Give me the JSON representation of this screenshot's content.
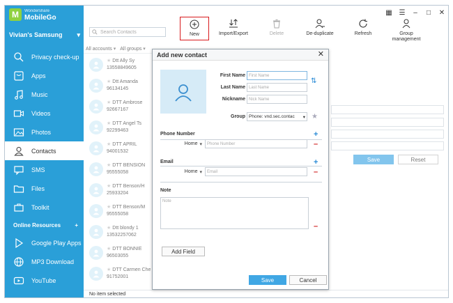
{
  "app": {
    "brand": "Wondershare",
    "product": "MobileGo",
    "device": "Vivian's Samsung"
  },
  "nav": {
    "items": [
      {
        "label": "Privacy check-up",
        "icon": "search-icon"
      },
      {
        "label": "Apps",
        "icon": "apps-icon"
      },
      {
        "label": "Music",
        "icon": "music-icon"
      },
      {
        "label": "Videos",
        "icon": "video-icon"
      },
      {
        "label": "Photos",
        "icon": "photo-icon"
      },
      {
        "label": "Contacts",
        "icon": "contacts-icon",
        "active": true
      },
      {
        "label": "SMS",
        "icon": "sms-icon"
      },
      {
        "label": "Files",
        "icon": "folder-icon"
      },
      {
        "label": "Toolkit",
        "icon": "toolkit-icon"
      }
    ],
    "online_header": "Online Resources",
    "online_items": [
      {
        "label": "Google Play Apps",
        "icon": "play-icon"
      },
      {
        "label": "MP3 Download",
        "icon": "globe-icon"
      },
      {
        "label": "YouTube",
        "icon": "youtube-icon"
      }
    ]
  },
  "search": {
    "placeholder": "Search Contacts"
  },
  "toolbar": {
    "new": "New",
    "import_export": "Import/Export",
    "delete": "Delete",
    "deduplicate": "De-duplicate",
    "refresh": "Refresh",
    "group_management": "Group management"
  },
  "filters": {
    "accounts": "All accounts",
    "groups": "All groups"
  },
  "contacts": [
    {
      "name": "Dtt Ally Sy",
      "phone": "13558849605"
    },
    {
      "name": "Dtt Amanda",
      "phone": "96134145"
    },
    {
      "name": "DTT Ambrose",
      "phone": "92667167"
    },
    {
      "name": "DTT Angel Ts",
      "phone": "92299463"
    },
    {
      "name": "DTT APRIL",
      "phone": "94001532"
    },
    {
      "name": "DTT BENSION",
      "phone": "95555058"
    },
    {
      "name": "DTT Benson/H",
      "phone": "25933204"
    },
    {
      "name": "DTT Benson/M",
      "phone": "95555058"
    },
    {
      "name": "Dtt blondy 1",
      "phone": "13532257062"
    },
    {
      "name": "DTT BONNIE",
      "phone": "96503055"
    },
    {
      "name": "DTT Carmen Che",
      "phone": "91752001"
    }
  ],
  "status": "No item selected",
  "background_form": {
    "save": "Save",
    "reset": "Reset"
  },
  "dialog": {
    "title": "Add new contact",
    "first_name_label": "First Name",
    "first_name_placeholder": "First Name",
    "last_name_label": "Last Name",
    "last_name_placeholder": "Last Name",
    "nickname_label": "Nickname",
    "nickname_placeholder": "Nick Name",
    "group_label": "Group",
    "group_value": "Phone: vnd.sec.contac",
    "phone_section": "Phone Number",
    "phone_type": "Home",
    "phone_placeholder": "Phone Number",
    "email_section": "Email",
    "email_type": "Home",
    "email_placeholder": "Email",
    "note_section": "Note",
    "note_placeholder": "Note",
    "add_field": "Add Field",
    "save": "Save",
    "cancel": "Cancel"
  },
  "colors": {
    "sidebar": "#2a9fd8",
    "accent": "#40a7e4",
    "highlight_border": "#d8181b",
    "logo": "#8fd13f"
  }
}
